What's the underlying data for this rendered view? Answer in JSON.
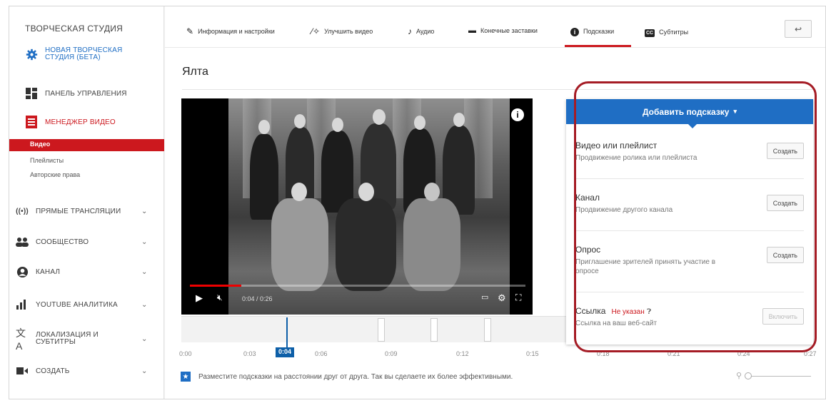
{
  "sidebar": {
    "title": "ТВОРЧЕСКАЯ СТУДИЯ",
    "items": [
      {
        "label": "НОВАЯ ТВОРЧЕСКАЯ СТУДИЯ (БЕТА)",
        "icon": "gear-icon"
      },
      {
        "label": "ПАНЕЛЬ УПРАВЛЕНИЯ",
        "icon": "dashboard-icon"
      },
      {
        "label": "МЕНЕДЖЕР ВИДЕО",
        "icon": "video-manager-icon"
      },
      {
        "label": "ПРЯМЫЕ ТРАНСЛЯЦИИ",
        "icon": "live-icon"
      },
      {
        "label": "СООБЩЕСТВО",
        "icon": "community-icon"
      },
      {
        "label": "КАНАЛ",
        "icon": "channel-icon"
      },
      {
        "label": "YOUTUBE АНАЛИТИКА",
        "icon": "analytics-icon"
      },
      {
        "label": "ЛОКАЛИЗАЦИЯ И СУБТИТРЫ",
        "icon": "translate-icon"
      },
      {
        "label": "СОЗДАТЬ",
        "icon": "create-icon"
      }
    ],
    "sub_items": [
      "Видео",
      "Плейлисты",
      "Авторские права"
    ]
  },
  "tabs": [
    {
      "label": "Информация и настройки"
    },
    {
      "label": "Улучшить видео"
    },
    {
      "label": "Аудио"
    },
    {
      "label": "Конечные заставки"
    },
    {
      "label": "Подсказки"
    },
    {
      "label": "Субтитры"
    }
  ],
  "active_tab": "Подсказки",
  "back_button": "↩",
  "video": {
    "title": "Ялта",
    "time": "0:04 / 0:26",
    "progress": 0.154
  },
  "timeline": {
    "ticks": [
      "0:00",
      "0:03",
      "0:06",
      "0:09",
      "0:12",
      "0:15",
      "0:18",
      "0:21",
      "0:24",
      "0:27"
    ],
    "current": "0:04"
  },
  "tip": "Разместите подсказки на расстоянии друг от друга. Так вы сделаете их более эффективными.",
  "panel": {
    "header": "Добавить подсказку",
    "rows": [
      {
        "title": "Видео или плейлист",
        "desc": "Продвижение ролика или плейлиста",
        "button": "Создать"
      },
      {
        "title": "Канал",
        "desc": "Продвижение другого канала",
        "button": "Создать"
      },
      {
        "title": "Опрос",
        "desc": "Приглашение зрителей принять участие в опросе",
        "button": "Создать"
      },
      {
        "title": "Ссылка",
        "status": "Не указан",
        "desc": "Ссылка на ваш веб-сайт",
        "button": "Включить"
      }
    ]
  },
  "colors": {
    "accent_red": "#cc181e",
    "accent_blue": "#1f6ec4",
    "highlight": "#a51c25"
  }
}
